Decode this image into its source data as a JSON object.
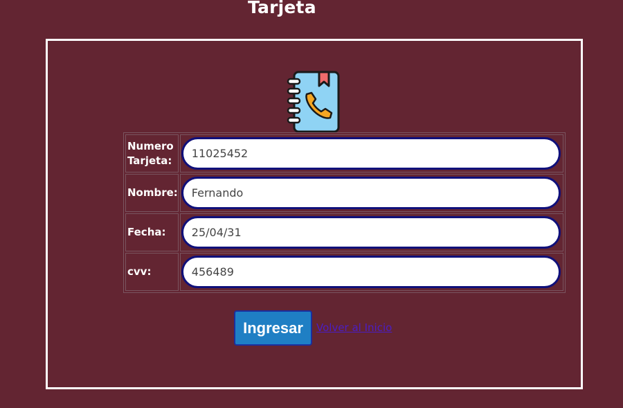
{
  "header": {
    "title": "Tarjeta"
  },
  "form": {
    "rows": [
      {
        "label": "Numero Tarjeta:",
        "value": "11025452"
      },
      {
        "label": "Nombre:",
        "value": "Fernando"
      },
      {
        "label": "Fecha:",
        "value": "25/04/31"
      },
      {
        "label": "cvv:",
        "value": "456489"
      }
    ]
  },
  "actions": {
    "submit_label": "Ingresar",
    "back_link_label": "Volver al Inicio"
  },
  "icon": {
    "name": "contact-book-phone-icon",
    "colors": {
      "cover": "#8fd3f4",
      "outline": "#1a1a1a",
      "bookmark": "#f06b6b",
      "phone": "#f5a623"
    }
  },
  "colors": {
    "background": "#632532",
    "frame_border": "#ffffff",
    "field_border": "#10107a",
    "button_bg": "#1f7fc4",
    "link": "#4b1ec4"
  }
}
